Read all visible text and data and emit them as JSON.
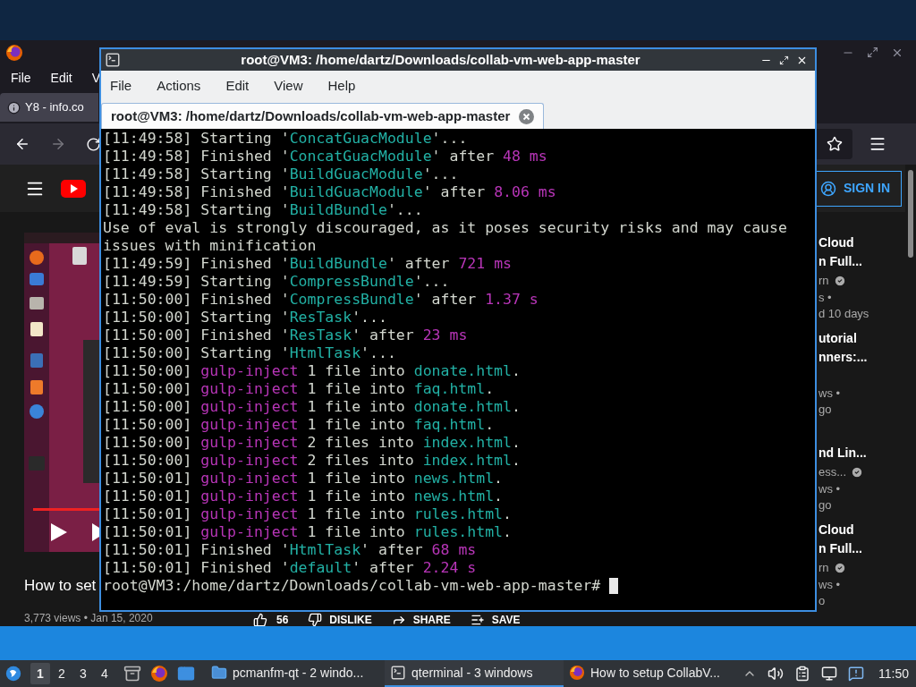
{
  "browser": {
    "menu": [
      "File",
      "Edit",
      "V"
    ],
    "tab": {
      "title": "Y8 - info.co",
      "selected": true
    },
    "youtube": {
      "sign_in": "SIGN IN"
    },
    "video": {
      "title": "How to set",
      "views": "3,773 views • Jan 15, 2020",
      "likes": "56",
      "actions": [
        {
          "kind": "dislike",
          "label": "DISLIKE"
        },
        {
          "kind": "share",
          "label": "SHARE"
        },
        {
          "kind": "save",
          "label": "SAVE"
        }
      ]
    },
    "sidebar": [
      {
        "title": [
          "Cloud",
          "n Full..."
        ],
        "channel": "rn",
        "verified": true,
        "meta": [
          "s •",
          "d 10 days"
        ]
      },
      {
        "title": [
          "utorial",
          "nners:..."
        ],
        "meta": [
          "ws •",
          "go"
        ]
      },
      {
        "title": [
          "nd Lin..."
        ],
        "channel": "ess...",
        "verified": true,
        "meta": [
          "ws •",
          "go"
        ]
      },
      {
        "title": [
          "Cloud",
          "n Full..."
        ],
        "channel": "rn",
        "verified": true,
        "meta": [
          "ws •",
          "o"
        ]
      }
    ]
  },
  "terminal": {
    "title": "root@VM3: /home/dartz/Downloads/collab-vm-web-app-master",
    "menu": [
      "File",
      "Actions",
      "Edit",
      "View",
      "Help"
    ],
    "tabs": [
      {
        "label": "root@VM3: /home/dartz/Downloads/collab-vm-web-app-master",
        "selected": true
      }
    ],
    "lines": [
      [
        {
          "kind": "plain",
          "text": "[11:49:58] Starting '"
        },
        {
          "kind": "name",
          "text": "ConcatGuacModule"
        },
        {
          "kind": "plain",
          "text": "'..."
        }
      ],
      [
        {
          "kind": "plain",
          "text": "[11:49:58] Finished '"
        },
        {
          "kind": "name",
          "text": "ConcatGuacModule"
        },
        {
          "kind": "plain",
          "text": "' after "
        },
        {
          "kind": "value",
          "text": "48 ms"
        }
      ],
      [
        {
          "kind": "plain",
          "text": "[11:49:58] Starting '"
        },
        {
          "kind": "name",
          "text": "BuildGuacModule"
        },
        {
          "kind": "plain",
          "text": "'..."
        }
      ],
      [
        {
          "kind": "plain",
          "text": "[11:49:58] Finished '"
        },
        {
          "kind": "name",
          "text": "BuildGuacModule"
        },
        {
          "kind": "plain",
          "text": "' after "
        },
        {
          "kind": "value",
          "text": "8.06 ms"
        }
      ],
      [
        {
          "kind": "plain",
          "text": "[11:49:58] Starting '"
        },
        {
          "kind": "name",
          "text": "BuildBundle"
        },
        {
          "kind": "plain",
          "text": "'..."
        }
      ],
      [
        {
          "kind": "plain",
          "text": "Use of eval is strongly discouraged, as it poses security risks and may cause issues with minification"
        }
      ],
      [
        {
          "kind": "plain",
          "text": "[11:49:59] Finished '"
        },
        {
          "kind": "name",
          "text": "BuildBundle"
        },
        {
          "kind": "plain",
          "text": "' after "
        },
        {
          "kind": "value",
          "text": "721 ms"
        }
      ],
      [
        {
          "kind": "plain",
          "text": "[11:49:59] Starting '"
        },
        {
          "kind": "name",
          "text": "CompressBundle"
        },
        {
          "kind": "plain",
          "text": "'..."
        }
      ],
      [
        {
          "kind": "plain",
          "text": "[11:50:00] Finished '"
        },
        {
          "kind": "name",
          "text": "CompressBundle"
        },
        {
          "kind": "plain",
          "text": "' after "
        },
        {
          "kind": "value",
          "text": "1.37 s"
        }
      ],
      [
        {
          "kind": "plain",
          "text": "[11:50:00] Starting '"
        },
        {
          "kind": "name",
          "text": "ResTask"
        },
        {
          "kind": "plain",
          "text": "'..."
        }
      ],
      [
        {
          "kind": "plain",
          "text": "[11:50:00] Finished '"
        },
        {
          "kind": "name",
          "text": "ResTask"
        },
        {
          "kind": "plain",
          "text": "' after "
        },
        {
          "kind": "value",
          "text": "23 ms"
        }
      ],
      [
        {
          "kind": "plain",
          "text": "[11:50:00] Starting '"
        },
        {
          "kind": "name",
          "text": "HtmlTask"
        },
        {
          "kind": "plain",
          "text": "'..."
        }
      ],
      [
        {
          "kind": "plain",
          "text": "[11:50:00] "
        },
        {
          "kind": "value",
          "text": "gulp-inject"
        },
        {
          "kind": "plain",
          "text": " 1 file into "
        },
        {
          "kind": "name",
          "text": "donate.html"
        },
        {
          "kind": "plain",
          "text": "."
        }
      ],
      [
        {
          "kind": "plain",
          "text": "[11:50:00] "
        },
        {
          "kind": "value",
          "text": "gulp-inject"
        },
        {
          "kind": "plain",
          "text": " 1 file into "
        },
        {
          "kind": "name",
          "text": "faq.html"
        },
        {
          "kind": "plain",
          "text": "."
        }
      ],
      [
        {
          "kind": "plain",
          "text": "[11:50:00] "
        },
        {
          "kind": "value",
          "text": "gulp-inject"
        },
        {
          "kind": "plain",
          "text": " 1 file into "
        },
        {
          "kind": "name",
          "text": "donate.html"
        },
        {
          "kind": "plain",
          "text": "."
        }
      ],
      [
        {
          "kind": "plain",
          "text": "[11:50:00] "
        },
        {
          "kind": "value",
          "text": "gulp-inject"
        },
        {
          "kind": "plain",
          "text": " 1 file into "
        },
        {
          "kind": "name",
          "text": "faq.html"
        },
        {
          "kind": "plain",
          "text": "."
        }
      ],
      [
        {
          "kind": "plain",
          "text": "[11:50:00] "
        },
        {
          "kind": "value",
          "text": "gulp-inject"
        },
        {
          "kind": "plain",
          "text": " 2 files into "
        },
        {
          "kind": "name",
          "text": "index.html"
        },
        {
          "kind": "plain",
          "text": "."
        }
      ],
      [
        {
          "kind": "plain",
          "text": "[11:50:00] "
        },
        {
          "kind": "value",
          "text": "gulp-inject"
        },
        {
          "kind": "plain",
          "text": " 2 files into "
        },
        {
          "kind": "name",
          "text": "index.html"
        },
        {
          "kind": "plain",
          "text": "."
        }
      ],
      [
        {
          "kind": "plain",
          "text": "[11:50:01] "
        },
        {
          "kind": "value",
          "text": "gulp-inject"
        },
        {
          "kind": "plain",
          "text": " 1 file into "
        },
        {
          "kind": "name",
          "text": "news.html"
        },
        {
          "kind": "plain",
          "text": "."
        }
      ],
      [
        {
          "kind": "plain",
          "text": "[11:50:01] "
        },
        {
          "kind": "value",
          "text": "gulp-inject"
        },
        {
          "kind": "plain",
          "text": " 1 file into "
        },
        {
          "kind": "name",
          "text": "news.html"
        },
        {
          "kind": "plain",
          "text": "."
        }
      ],
      [
        {
          "kind": "plain",
          "text": "[11:50:01] "
        },
        {
          "kind": "value",
          "text": "gulp-inject"
        },
        {
          "kind": "plain",
          "text": " 1 file into "
        },
        {
          "kind": "name",
          "text": "rules.html"
        },
        {
          "kind": "plain",
          "text": "."
        }
      ],
      [
        {
          "kind": "plain",
          "text": "[11:50:01] "
        },
        {
          "kind": "value",
          "text": "gulp-inject"
        },
        {
          "kind": "plain",
          "text": " 1 file into "
        },
        {
          "kind": "name",
          "text": "rules.html"
        },
        {
          "kind": "plain",
          "text": "."
        }
      ],
      [
        {
          "kind": "plain",
          "text": "[11:50:01] Finished '"
        },
        {
          "kind": "name",
          "text": "HtmlTask"
        },
        {
          "kind": "plain",
          "text": "' after "
        },
        {
          "kind": "value",
          "text": "68 ms"
        }
      ],
      [
        {
          "kind": "plain",
          "text": "[11:50:01] Finished '"
        },
        {
          "kind": "name",
          "text": "default"
        },
        {
          "kind": "plain",
          "text": "' after "
        },
        {
          "kind": "value",
          "text": "2.24 s"
        }
      ]
    ],
    "prompt": "root@VM3:/home/dartz/Downloads/collab-vm-web-app-master#"
  },
  "taskbar": {
    "workspaces": [
      {
        "label": "1",
        "selected": true
      },
      {
        "label": "2",
        "selected": false
      },
      {
        "label": "3",
        "selected": false
      },
      {
        "label": "4",
        "selected": false
      }
    ],
    "tasks": [
      {
        "kind": "folder",
        "label": "pcmanfm-qt - 2 windo...",
        "selected": false
      },
      {
        "kind": "terminal",
        "label": "qterminal - 3 windows",
        "selected": true
      },
      {
        "kind": "browser",
        "label": "How to setup CollabV...",
        "selected": false
      }
    ],
    "clock": "11:50"
  }
}
